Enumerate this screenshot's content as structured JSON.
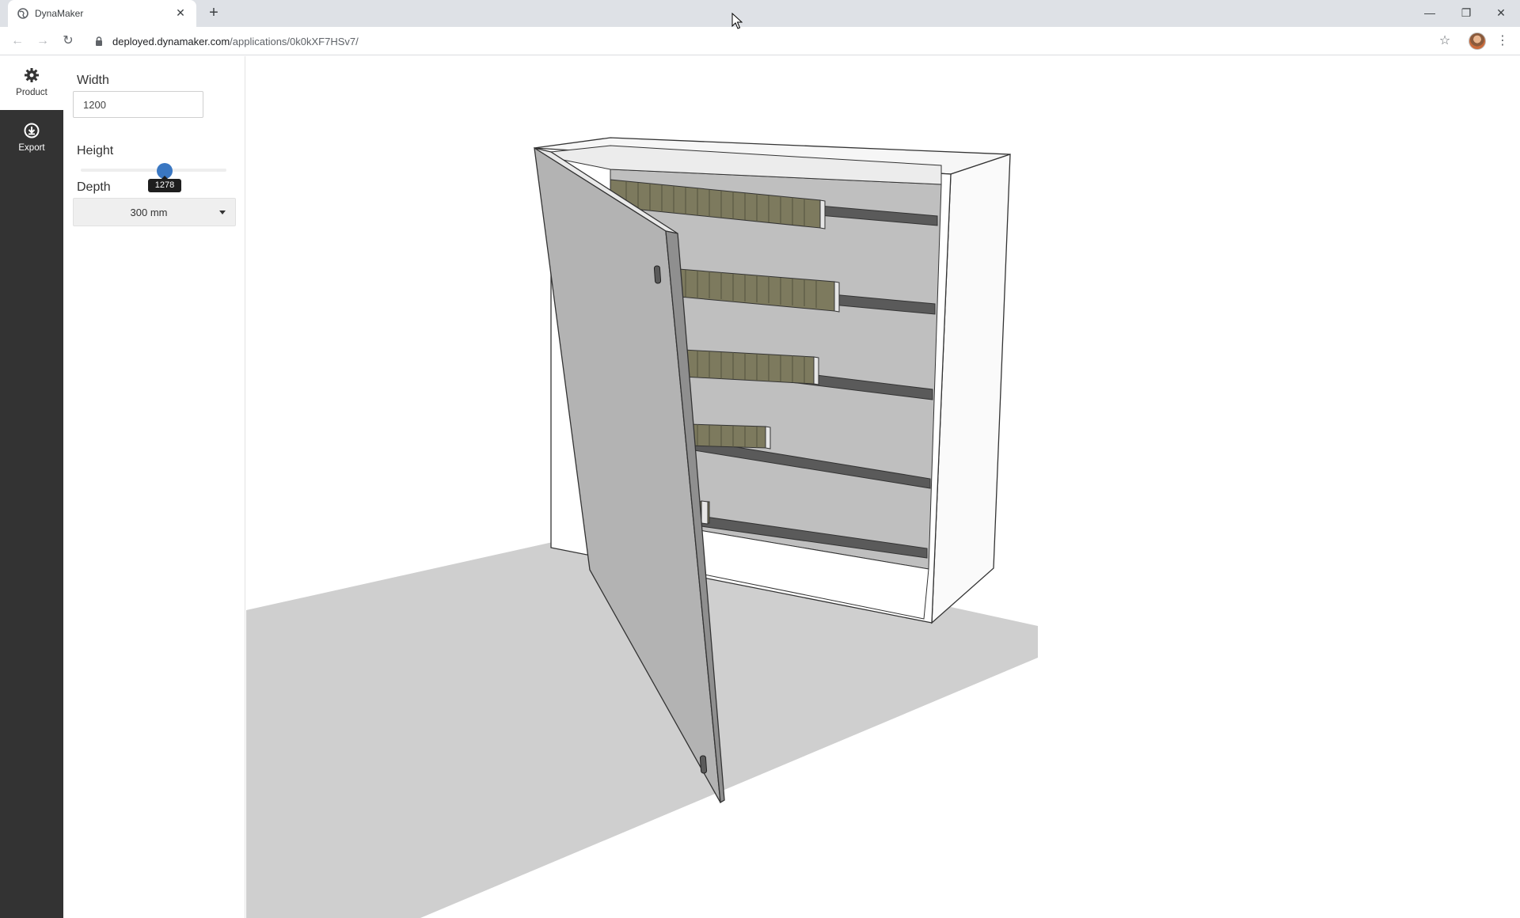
{
  "browser": {
    "tab_title": "DynaMaker",
    "tab_close": "✕",
    "new_tab": "+",
    "url_domain": "deployed.dynamaker.com",
    "url_path": "/applications/0k0kXF7HSv7/",
    "window_controls": {
      "minimize": "—",
      "restore": "❐",
      "close": "✕"
    },
    "icons": [
      "globe-icon",
      "back-icon",
      "forward-icon",
      "reload-icon",
      "lock-icon",
      "star-icon",
      "avatar",
      "menu-dots-icon"
    ]
  },
  "sidebar": {
    "items": [
      {
        "label": "Product",
        "icon": "gear-icon",
        "active": true
      },
      {
        "label": "Export",
        "icon": "download-icon",
        "active": false
      }
    ]
  },
  "panel": {
    "width": {
      "label": "Width",
      "value": "1200"
    },
    "height": {
      "label": "Height",
      "value": "1278",
      "fraction": 0.58
    },
    "depth": {
      "label": "Depth",
      "selected": "300 mm"
    }
  },
  "viewport": {
    "model": "cabinet with open door and five DIN rails",
    "colors": {
      "shadow": "#cfcfcf",
      "door": "#b3b3b3",
      "back_panel": "#bfbfbf",
      "rail": "#5a5a5a",
      "terminal": "#7d7a5e",
      "accent": "#3a77c2"
    }
  }
}
